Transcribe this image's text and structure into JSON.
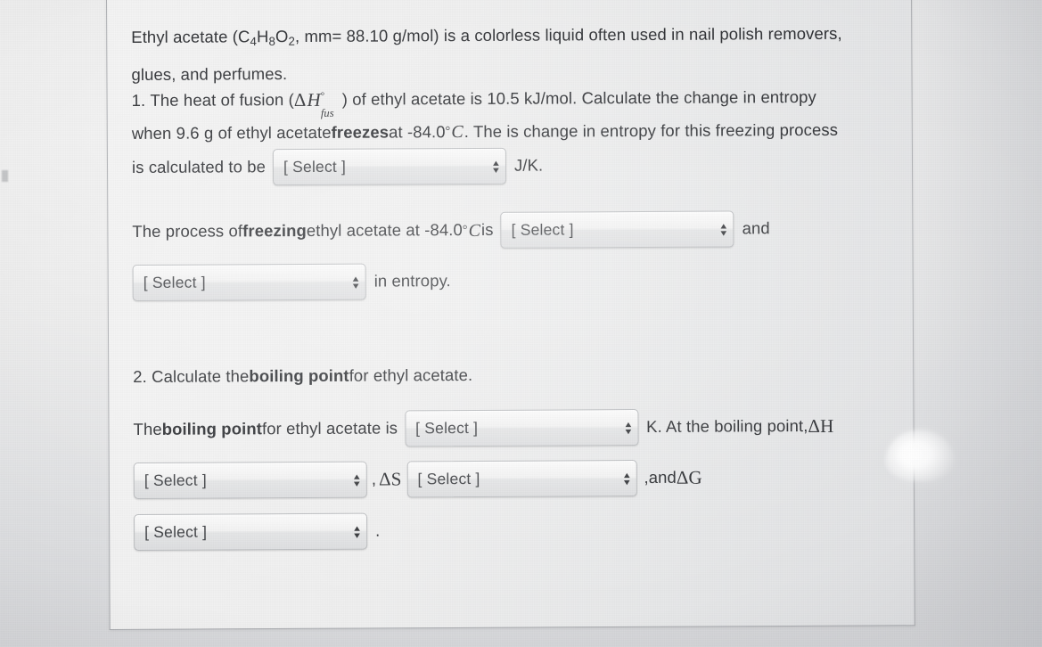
{
  "document": {
    "intro": {
      "line1_a": "Ethyl acetate (C",
      "line1_sub1": "4",
      "line1_b": "H",
      "line1_sub2": "8",
      "line1_c": "O",
      "line1_sub3": "2",
      "line1_d": ", mm= 88.10 g/mol) is a colorless liquid often used in nail polish removers,",
      "line2": "glues, and perfumes."
    },
    "question1": {
      "number": "1.",
      "text_a": "The heat of fusion (",
      "symbol_delta_h": "ΔH",
      "symbol_degree": "°",
      "symbol_fus": "fus",
      "text_b": ") of ethyl acetate is 10.5 kJ/mol.  Calculate the change in entropy",
      "line2_a": "when 9.6 g of ethyl acetate ",
      "line2_bold": "freezes",
      "line2_b": " at -84.0 ",
      "line2_degree": "°",
      "line2_c_italic": "C",
      "line2_d": ". The is change in entropy for this freezing process",
      "line3_a": "is calculated to be",
      "line3_unit": "J/K.",
      "select_entropy_value": "[ Select ]"
    },
    "statement": {
      "part_a": "The process of ",
      "bold_freezing": "freezing",
      "part_b": " ethyl acetate at -84.0 ",
      "degree": "°",
      "italic_c": "C",
      "part_c": " is",
      "select_spontaneity": "[ Select ]",
      "and": "and",
      "select_entropy_direction": "[ Select ]",
      "part_d": "in entropy."
    },
    "question2": {
      "number": "2.",
      "text": "Calculate the ",
      "bold": "boiling point",
      "text_b": " for ethyl acetate.",
      "line1_a": "The ",
      "line1_bold": "boiling point",
      "line1_b": " for ethyl acetate is",
      "select_boiling_point": "[ Select ]",
      "line1_c": "K. At the boiling point, ",
      "symbol_delta_h": "ΔH",
      "select_dh_sign": "[ Select ]",
      "comma": ",",
      "symbol_delta_s": "ΔS",
      "select_ds_sign": "[ Select ]",
      "and_text": ",and ",
      "symbol_delta_g": "ΔG",
      "select_dg_sign": "[ Select ]",
      "period": "."
    }
  },
  "ui": {
    "select_arrow_up": "▲",
    "select_arrow_down": "▼"
  },
  "colors": {
    "page_background": "#d9dadc",
    "panel_background": "#efefef",
    "text": "#232529",
    "select_border": "#b7b9bc"
  }
}
